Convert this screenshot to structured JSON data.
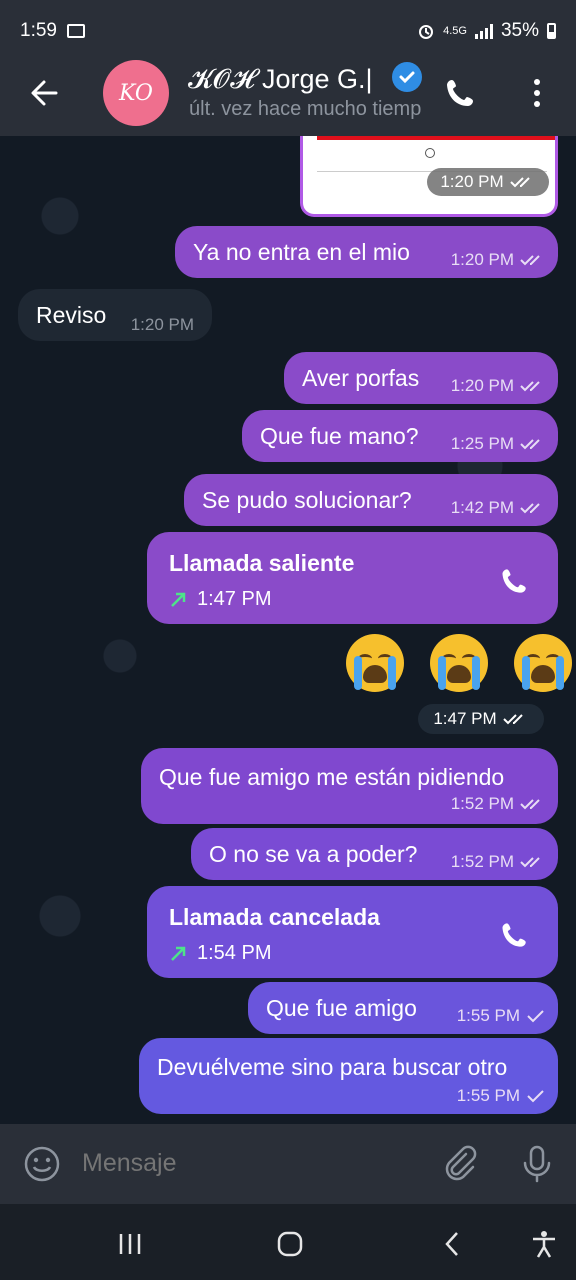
{
  "status_bar": {
    "time": "1:59",
    "network": "4.5G",
    "battery": "35%"
  },
  "header": {
    "avatar_initials": "KO",
    "contact_name": "𝓚𝓞𝓗 Jorge G.|",
    "last_seen": "últ. vez hace mucho tiempo"
  },
  "messages": [
    {
      "type": "image",
      "direction": "out",
      "time": "1:20 PM"
    },
    {
      "type": "text",
      "direction": "out",
      "text": "Ya no entra en el mio",
      "time": "1:20 PM"
    },
    {
      "type": "text",
      "direction": "in",
      "text": "Reviso",
      "time": "1:20 PM"
    },
    {
      "type": "text",
      "direction": "out",
      "text": "Aver porfas",
      "time": "1:20 PM"
    },
    {
      "type": "text",
      "direction": "out",
      "text": "Que fue mano?",
      "time": "1:25 PM"
    },
    {
      "type": "text",
      "direction": "out",
      "text": "Se pudo solucionar?",
      "time": "1:42 PM"
    },
    {
      "type": "call",
      "direction": "out",
      "title": "Llamada saliente",
      "time": "1:47 PM"
    },
    {
      "type": "emoji",
      "direction": "out",
      "emoji": "😭😭😭",
      "time": "1:47 PM"
    },
    {
      "type": "text",
      "direction": "out",
      "text": "Que fue amigo me están pidiendo",
      "time": "1:52 PM"
    },
    {
      "type": "text",
      "direction": "out",
      "text": "O no se va a poder?",
      "time": "1:52 PM"
    },
    {
      "type": "call",
      "direction": "out",
      "title": "Llamada cancelada",
      "time": "1:54 PM"
    },
    {
      "type": "text",
      "direction": "out",
      "text": "Que fue amigo",
      "time": "1:55 PM"
    },
    {
      "type": "text",
      "direction": "out",
      "text": "Devuélveme sino para buscar otro",
      "time": "1:55 PM"
    }
  ],
  "input": {
    "placeholder": "Mensaje"
  },
  "colors": {
    "outgoing_bubble": "#8a4bc9",
    "incoming_bubble": "#1f2833",
    "verified_badge": "#2f8de4",
    "call_arrow": "#4ee38a",
    "avatar": "#ef6f8e"
  }
}
